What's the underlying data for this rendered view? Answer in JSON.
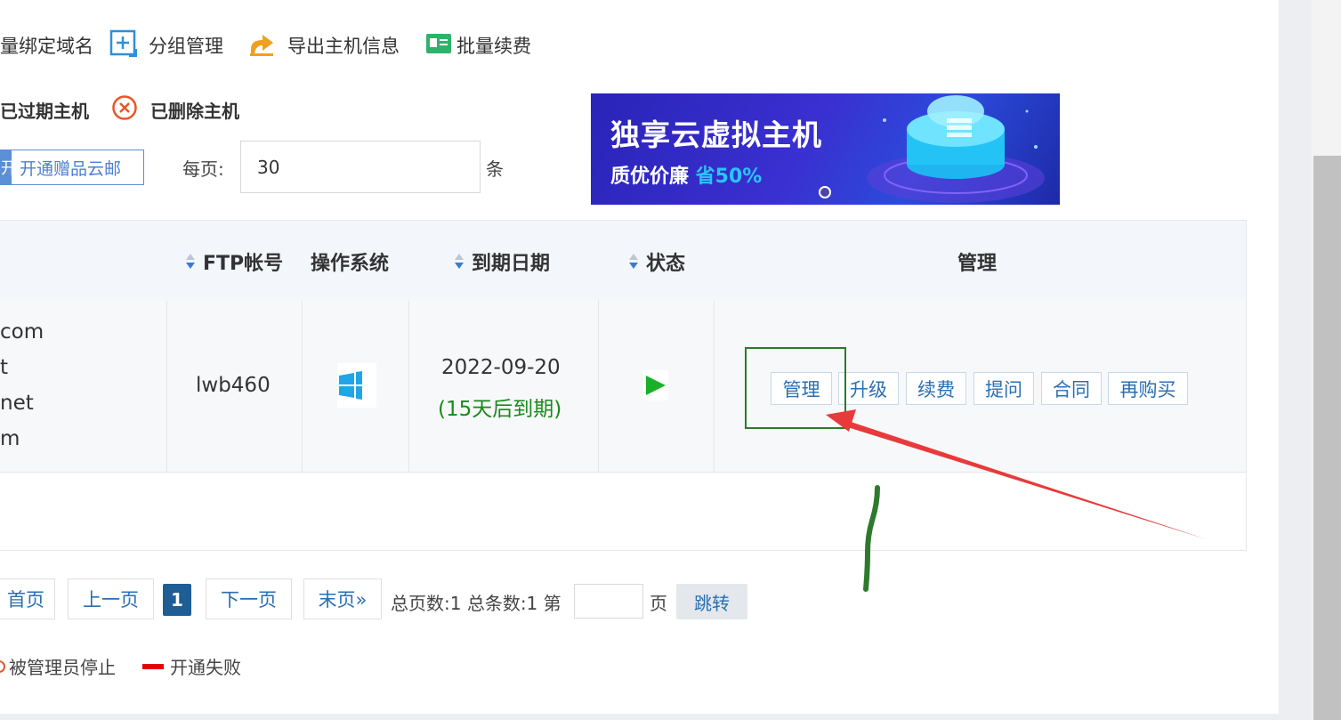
{
  "toolbar": {
    "bind_domain": "量绑定域名",
    "group_manage": "分组管理",
    "export_host": "导出主机信息",
    "batch_renew": "批量续费"
  },
  "filters": {
    "expired": "已过期主机",
    "deleted": "已删除主机"
  },
  "promo": {
    "left_glyph": "开",
    "label": "开通赠品云邮"
  },
  "per_page": {
    "label": "每页:",
    "value": "30",
    "unit": "条"
  },
  "banner": {
    "title": "独享云虚拟主机",
    "sub_prefix": "质优价廉 ",
    "sub_highlight": "省50%"
  },
  "table": {
    "headers": {
      "ftp": "FTP帐号",
      "os": "操作系统",
      "expire": "到期日期",
      "status": "状态",
      "manage": "管理"
    },
    "row": {
      "domains": [
        "com",
        "t",
        "net",
        "m"
      ],
      "ftp": "lwb460",
      "os_icon": "windows-icon",
      "expire_date": "2022-09-20",
      "expire_note": "(15天后到期)",
      "status_icon": "play-icon",
      "actions": [
        "管理",
        "升级",
        "续费",
        "提问",
        "合同",
        "再购买"
      ]
    }
  },
  "pagination": {
    "first": "首页",
    "prev": "上一页",
    "current": "1",
    "next": "下一页",
    "last": "末页»",
    "info": "总页数:1 总条数:1 第",
    "page_unit": "页",
    "jump": "跳转"
  },
  "legend": {
    "admin_stopped": "被管理员停止",
    "open_failed": "开通失败"
  },
  "colors": {
    "link_blue": "#2a6fb3",
    "annotation_green": "#2a7a2a",
    "annotation_red": "#e83a3a",
    "expire_green": "#1a8a1a"
  }
}
